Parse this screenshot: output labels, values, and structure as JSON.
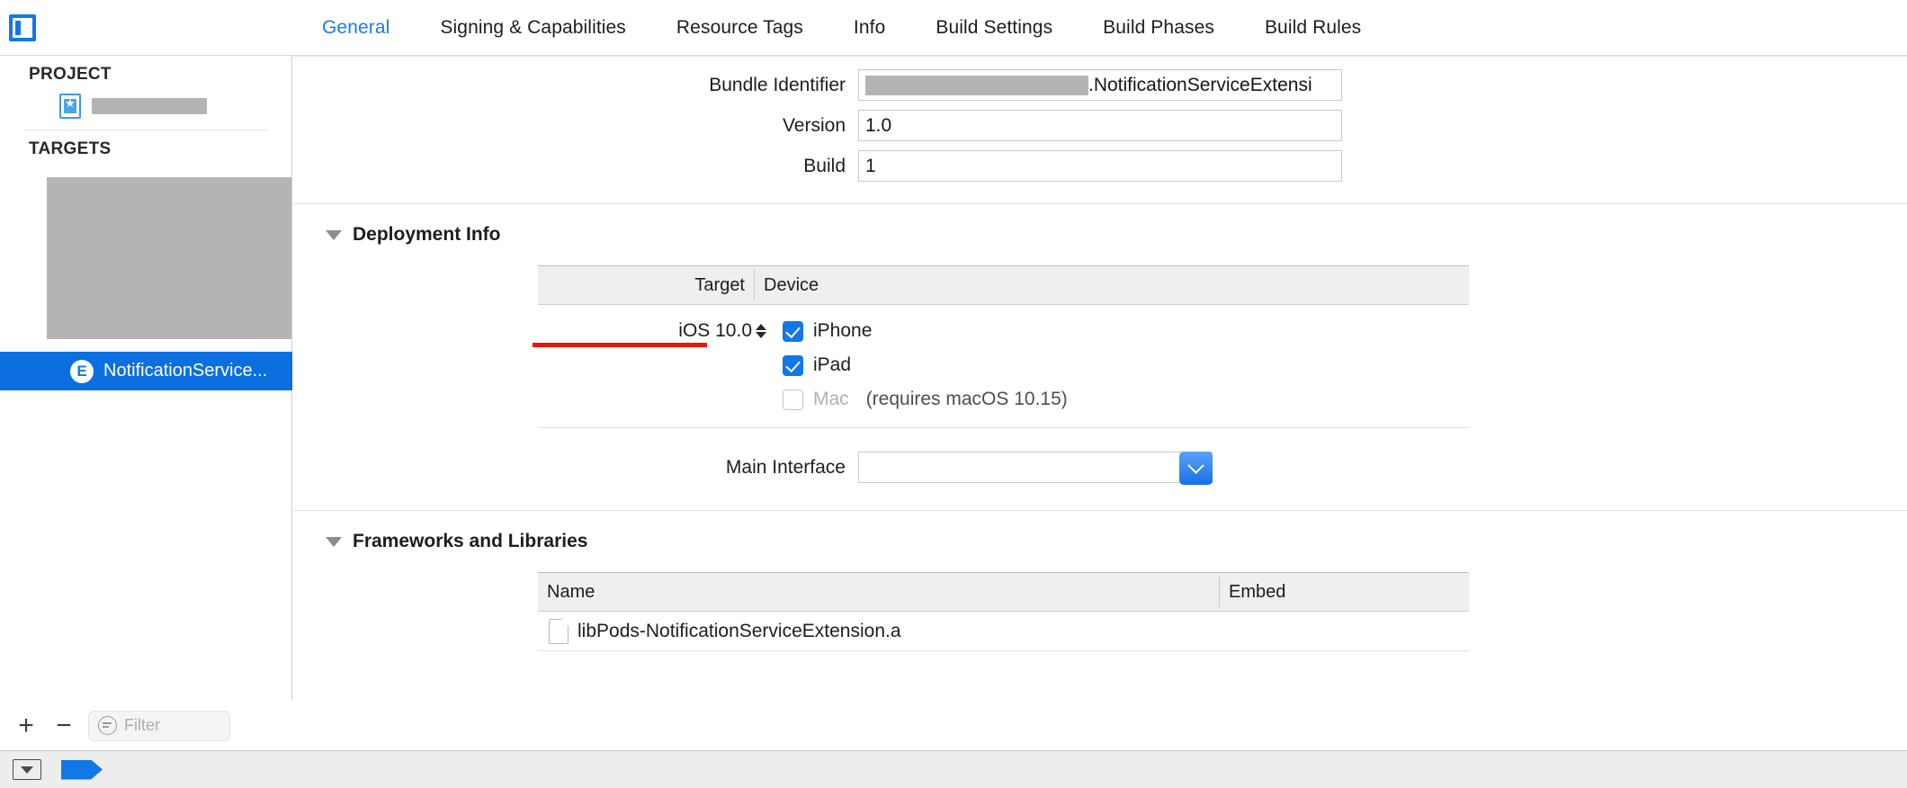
{
  "toolbar": {
    "nav_toggle_name": "navigator-toggle",
    "tabs": [
      {
        "label": "General",
        "active": true
      },
      {
        "label": "Signing & Capabilities",
        "active": false
      },
      {
        "label": "Resource Tags",
        "active": false
      },
      {
        "label": "Info",
        "active": false
      },
      {
        "label": "Build Settings",
        "active": false
      },
      {
        "label": "Build Phases",
        "active": false
      },
      {
        "label": "Build Rules",
        "active": false
      }
    ]
  },
  "sidebar": {
    "project_header": "PROJECT",
    "project_item": {
      "name_redacted": true
    },
    "targets_header": "TARGETS",
    "targets": [
      {
        "label": "",
        "redacted": true,
        "selected": false
      },
      {
        "label": "NotificationService...",
        "badge": "E",
        "selected": true
      }
    ],
    "footer": {
      "add_label": "+",
      "remove_label": "−",
      "filter_placeholder": "Filter",
      "filter_value": ""
    }
  },
  "identity": {
    "bundle_identifier": {
      "label": "Bundle Identifier",
      "prefix_redacted": true,
      "value_suffix": ".NotificationServiceExtensi"
    },
    "version": {
      "label": "Version",
      "value": "1.0"
    },
    "build": {
      "label": "Build",
      "value": "1"
    }
  },
  "deployment_info": {
    "title": "Deployment Info",
    "columns": {
      "target": "Target",
      "device": "Device"
    },
    "os_version": "iOS 10.0",
    "highlight_color": "#e8160c",
    "devices": [
      {
        "label": "iPhone",
        "checked": true,
        "note": "",
        "disabled": false
      },
      {
        "label": "iPad",
        "checked": true,
        "note": "",
        "disabled": false
      },
      {
        "label": "Mac",
        "checked": false,
        "note": "(requires macOS 10.15)",
        "disabled": true
      }
    ],
    "main_interface": {
      "label": "Main Interface",
      "value": ""
    }
  },
  "frameworks": {
    "title": "Frameworks and Libraries",
    "columns": {
      "name": "Name",
      "embed": "Embed"
    },
    "items": [
      {
        "name": "libPods-NotificationServiceExtension.a",
        "embed": ""
      }
    ]
  },
  "statusbar": {
    "left_button": "bottom-panel-toggle",
    "flag": "issue-flag"
  },
  "colors": {
    "accent": "#1277e8",
    "selection": "#0b6fe0",
    "highlight": "#e8160c",
    "header_bg": "#efefef"
  }
}
